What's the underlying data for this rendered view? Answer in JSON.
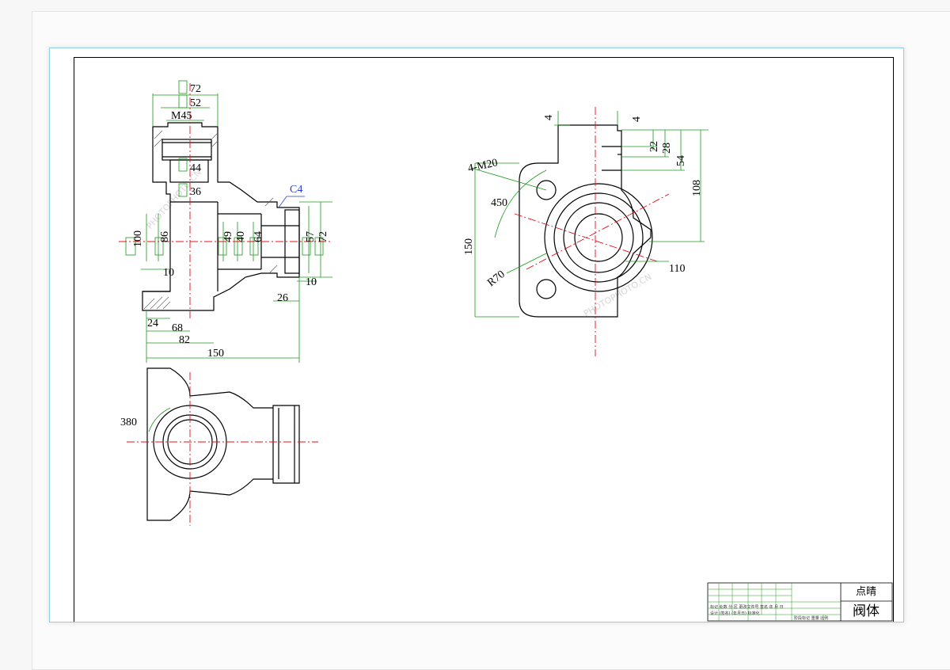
{
  "title_block": {
    "company": "点晴",
    "part_name": "阀体",
    "note_row1": "标记 处数 分 区 更改文件号 签名 年 月 日",
    "note_row2": "设计 (签名) (年月日) 标准化",
    "note_row3": "阶段标记 重量 比例"
  },
  "watermark": {
    "text1": "PHOTOPHOTO.CN",
    "text2": "PHOTOPHOTO.CN"
  },
  "dimensions": {
    "front": {
      "d72": "72",
      "d52": "52",
      "m45": "M45",
      "d44": "44",
      "d36": "36",
      "c4": "C4",
      "d100": "100",
      "d86": "86",
      "d49": "49",
      "d40": "40",
      "d64": "64",
      "d57": "57",
      "d72b": "72",
      "d10a": "10",
      "d10b": "10",
      "d24": "24",
      "d68": "68",
      "d82": "82",
      "d26": "26",
      "d150": "150"
    },
    "side": {
      "d4a": "4",
      "d4b": "4",
      "d22": "22",
      "d28": "28",
      "d54": "54",
      "d108": "108",
      "m20": "4-M20",
      "d450": "450",
      "d150": "150",
      "r70": "R70",
      "d110": "110"
    },
    "top": {
      "d380": "380"
    }
  },
  "colors": {
    "outline": "#000000",
    "dimension": "#1a9a1a",
    "centerline": "#e8101a",
    "annotation": "#2a3fd0",
    "sheet_border": "#8fd0e6"
  }
}
